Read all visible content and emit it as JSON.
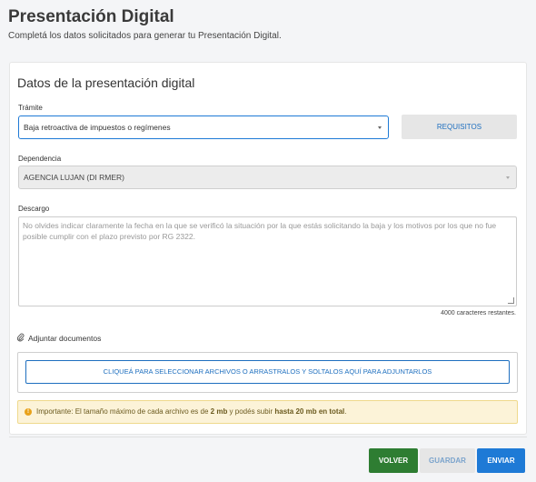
{
  "header": {
    "title": "Presentación Digital",
    "subtitle": "Completá los datos solicitados para generar tu Presentación Digital."
  },
  "form": {
    "section_title": "Datos de la presentación digital",
    "tramite": {
      "label": "Trámite",
      "value": "Baja retroactiva de impuestos o regímenes"
    },
    "requisitos_label": "REQUISITOS",
    "dependencia": {
      "label": "Dependencia",
      "value": "AGENCIA LUJAN (DI RMER)"
    },
    "descargo": {
      "label": "Descargo",
      "placeholder": "No olvides indicar claramente la fecha en la que se verificó la situación por la que estás solicitando la baja y los motivos por los que no fue posible cumplir con el plazo previsto por RG 2322.",
      "counter": "4000 caracteres restantes."
    },
    "attach": {
      "label": "Adjuntar documentos",
      "dropzone": "CLIQUEÁ PARA SELECCIONAR ARCHIVOS O ARRASTRALOS Y SOLTALOS AQUÍ PARA ADJUNTARLOS"
    },
    "alert": {
      "prefix": "Importante: El tamaño máximo de cada archivo es de ",
      "size": "2 mb",
      "middle": " y podés subir ",
      "total": "hasta 20 mb en total",
      "suffix": "."
    }
  },
  "footer": {
    "back_label": "VOLVER",
    "save_label": "GUARDAR",
    "send_label": "ENVIAR"
  },
  "colors": {
    "primary": "#1e7ad6",
    "success": "#2e7d32",
    "warning_bg": "#fcf3d8"
  }
}
